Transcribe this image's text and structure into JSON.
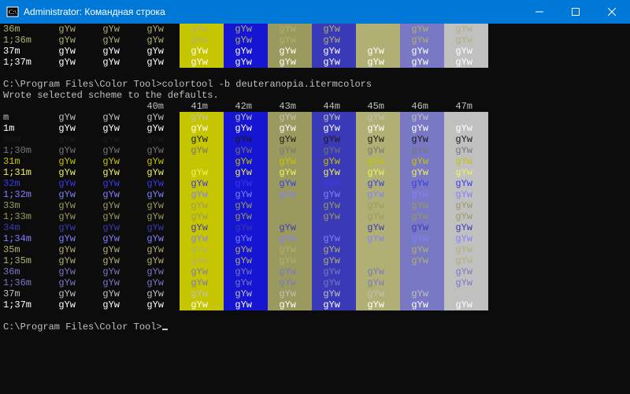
{
  "window": {
    "title": "Administrator: Командная строка"
  },
  "sample": "gYw",
  "prompt_dir": "C:\\Program Files\\Color Tool>",
  "command": "colortool -b deuteranopia.itermcolors",
  "response": "Wrote selected scheme to the defaults.",
  "bg_headers": [
    "40m",
    "41m",
    "42m",
    "43m",
    "44m",
    "45m",
    "46m",
    "47m"
  ],
  "bg_classes": [
    "bg-black",
    "bg-yellow",
    "bg-blue",
    "bg-olive",
    "bg-dblue",
    "bg-olive2",
    "bg-violet",
    "bg-silver"
  ],
  "top_rows": [
    {
      "label": "36m",
      "fg": "fg-olive2"
    },
    {
      "label": "1;36m",
      "fg": "fg-olive2"
    },
    {
      "label": "37m",
      "fg": "fg-white"
    },
    {
      "label": "1;37m",
      "fg": "fg-white"
    }
  ],
  "main_rows": [
    {
      "label": "m",
      "fg": "fg-gray"
    },
    {
      "label": "1m",
      "fg": "fg-white"
    },
    {
      "label": "30m",
      "fg": "fg-black"
    },
    {
      "label": "1;30m",
      "fg": "fg-dgray"
    },
    {
      "label": "31m",
      "fg": "fg-yellow"
    },
    {
      "label": "1;31m",
      "fg": "fg-lyellow"
    },
    {
      "label": "32m",
      "fg": "fg-blue"
    },
    {
      "label": "1;32m",
      "fg": "fg-lblue"
    },
    {
      "label": "33m",
      "fg": "fg-olive"
    },
    {
      "label": "1;33m",
      "fg": "fg-olive"
    },
    {
      "label": "34m",
      "fg": "fg-dblue"
    },
    {
      "label": "1;34m",
      "fg": "fg-lblue"
    },
    {
      "label": "35m",
      "fg": "fg-olive2"
    },
    {
      "label": "1;35m",
      "fg": "fg-olive2"
    },
    {
      "label": "36m",
      "fg": "fg-violet"
    },
    {
      "label": "1;36m",
      "fg": "fg-violet"
    },
    {
      "label": "37m",
      "fg": "fg-gray"
    },
    {
      "label": "1;37m",
      "fg": "fg-white"
    }
  ]
}
